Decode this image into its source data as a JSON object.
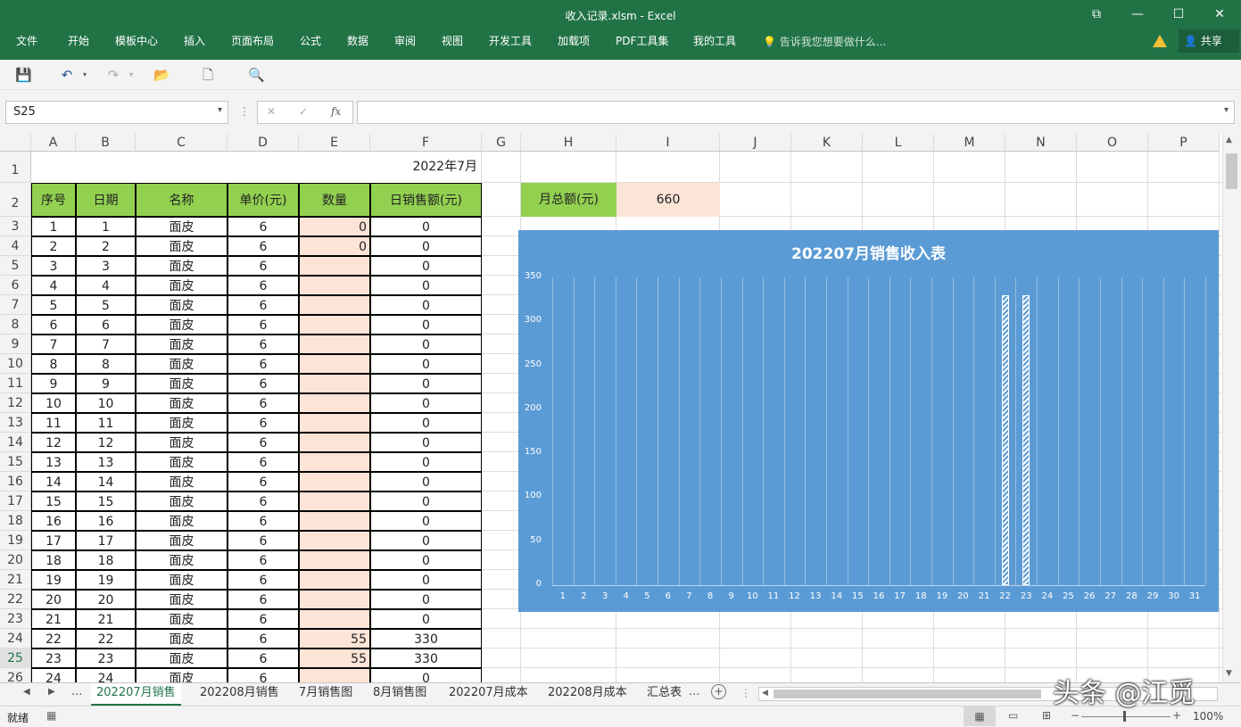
{
  "window": {
    "title": "收入记录.xlsm - Excel"
  },
  "menu": {
    "items": [
      "文件",
      "开始",
      "模板中心",
      "插入",
      "页面布局",
      "公式",
      "数据",
      "审阅",
      "视图",
      "开发工具",
      "加载项",
      "PDF工具集",
      "我的工具"
    ],
    "tell_me": "告诉我您想要做什么...",
    "share": "共享"
  },
  "formula_bar": {
    "name_box": "S25",
    "fx": "fx",
    "cancel": "✕",
    "enter": "✓",
    "value": ""
  },
  "columns": [
    "A",
    "B",
    "C",
    "D",
    "E",
    "F",
    "G",
    "H",
    "I",
    "J",
    "K",
    "L",
    "M",
    "N",
    "O",
    "P"
  ],
  "sheet": {
    "title_cell": "2022年7月",
    "headers": [
      "序号",
      "日期",
      "名称",
      "单价(元)",
      "数量",
      "日销售额(元)"
    ],
    "month_total_label": "月总额(元)",
    "month_total_value": "660",
    "rows": [
      [
        "3",
        "1",
        "1",
        "面皮",
        "6",
        "0",
        "0"
      ],
      [
        "4",
        "2",
        "2",
        "面皮",
        "6",
        "0",
        "0"
      ],
      [
        "5",
        "3",
        "3",
        "面皮",
        "6",
        "",
        "0"
      ],
      [
        "6",
        "4",
        "4",
        "面皮",
        "6",
        "",
        "0"
      ],
      [
        "7",
        "5",
        "5",
        "面皮",
        "6",
        "",
        "0"
      ],
      [
        "8",
        "6",
        "6",
        "面皮",
        "6",
        "",
        "0"
      ],
      [
        "9",
        "7",
        "7",
        "面皮",
        "6",
        "",
        "0"
      ],
      [
        "10",
        "8",
        "8",
        "面皮",
        "6",
        "",
        "0"
      ],
      [
        "11",
        "9",
        "9",
        "面皮",
        "6",
        "",
        "0"
      ],
      [
        "12",
        "10",
        "10",
        "面皮",
        "6",
        "",
        "0"
      ],
      [
        "13",
        "11",
        "11",
        "面皮",
        "6",
        "",
        "0"
      ],
      [
        "14",
        "12",
        "12",
        "面皮",
        "6",
        "",
        "0"
      ],
      [
        "15",
        "13",
        "13",
        "面皮",
        "6",
        "",
        "0"
      ],
      [
        "16",
        "14",
        "14",
        "面皮",
        "6",
        "",
        "0"
      ],
      [
        "17",
        "15",
        "15",
        "面皮",
        "6",
        "",
        "0"
      ],
      [
        "18",
        "16",
        "16",
        "面皮",
        "6",
        "",
        "0"
      ],
      [
        "19",
        "17",
        "17",
        "面皮",
        "6",
        "",
        "0"
      ],
      [
        "20",
        "18",
        "18",
        "面皮",
        "6",
        "",
        "0"
      ],
      [
        "21",
        "19",
        "19",
        "面皮",
        "6",
        "",
        "0"
      ],
      [
        "22",
        "20",
        "20",
        "面皮",
        "6",
        "",
        "0"
      ],
      [
        "23",
        "21",
        "21",
        "面皮",
        "6",
        "",
        "0"
      ],
      [
        "24",
        "22",
        "22",
        "面皮",
        "6",
        "55",
        "330"
      ],
      [
        "25",
        "23",
        "23",
        "面皮",
        "6",
        "55",
        "330"
      ],
      [
        "26",
        "24",
        "24",
        "面皮",
        "6",
        "",
        "0"
      ]
    ]
  },
  "chart_data": {
    "type": "bar",
    "title": "202207月销售收入表",
    "categories": [
      "1",
      "2",
      "3",
      "4",
      "5",
      "6",
      "7",
      "8",
      "9",
      "10",
      "11",
      "12",
      "13",
      "14",
      "15",
      "16",
      "17",
      "18",
      "19",
      "20",
      "21",
      "22",
      "23",
      "24",
      "25",
      "26",
      "27",
      "28",
      "29",
      "30",
      "31"
    ],
    "values": [
      0,
      0,
      0,
      0,
      0,
      0,
      0,
      0,
      0,
      0,
      0,
      0,
      0,
      0,
      0,
      0,
      0,
      0,
      0,
      0,
      0,
      330,
      330,
      0,
      0,
      0,
      0,
      0,
      0,
      0,
      0
    ],
    "ylim": [
      0,
      350
    ],
    "yticks": [
      "0",
      "50",
      "100",
      "150",
      "200",
      "250",
      "300",
      "350"
    ],
    "grid": true,
    "colors": {
      "background": "#5b9bd5",
      "bar": "#ffffff"
    }
  },
  "tabs": {
    "items": [
      "202207月销售",
      "202208月销售",
      "7月销售图",
      "8月销售图",
      "202207月成本",
      "202208月成本",
      "汇总表"
    ],
    "active": 0,
    "ellipsis": "...",
    "more": "..."
  },
  "status": {
    "text": "就绪",
    "zoom": "100%"
  },
  "watermark": "头条 @江觅",
  "colors": {
    "brand": "#217346",
    "header_green": "#92d050",
    "peach": "#fce4d6"
  }
}
